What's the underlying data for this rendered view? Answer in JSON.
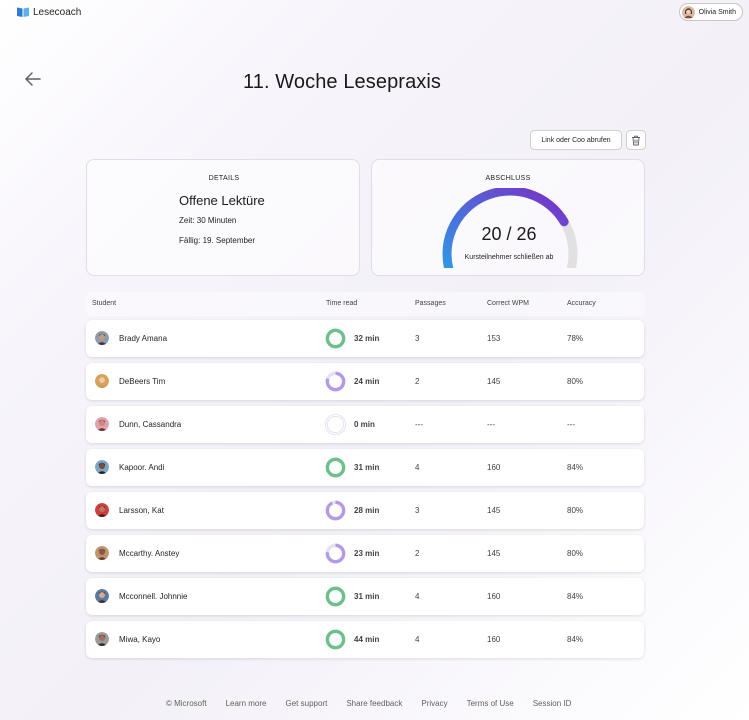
{
  "app": {
    "name": "Lesecoach",
    "user_name": "Olivia Smith"
  },
  "page": {
    "title": "11. Woche Lesepraxis"
  },
  "toolbar": {
    "link_label": "Link oder Coo abrufen"
  },
  "details": {
    "label": "DETAILS",
    "title": "Offene Lektüre",
    "time": "Zeit: 30 Minuten",
    "due": "Fällig: 19. September"
  },
  "completion": {
    "label": "ABSCHLUSS",
    "value_text": "20 / 26",
    "completed": 20,
    "total": 26,
    "caption": "Kursteilnehmer schließen ab"
  },
  "table": {
    "headers": {
      "student": "Student",
      "time_read": "Time read",
      "passages": "Passages",
      "wpm": "Correct WPM",
      "accuracy": "Accuracy"
    },
    "rows": [
      {
        "name": "Brady Amana",
        "time": "32 min",
        "progress": 1.0,
        "passages": "3",
        "wpm": "153",
        "accuracy": "78%",
        "ring_color": "#6cc08a"
      },
      {
        "name": "DeBeers Tim",
        "time": "24 min",
        "progress": 0.8,
        "passages": "2",
        "wpm": "145",
        "accuracy": "80%",
        "ring_color": "#b39ae8"
      },
      {
        "name": "Dunn, Cassandra",
        "time": "0 min",
        "progress": 0.0,
        "passages": "---",
        "wpm": "---",
        "accuracy": "---",
        "ring_color": "#b39ae8"
      },
      {
        "name": "Kapoor. Andi",
        "time": "31 min",
        "progress": 1.0,
        "passages": "4",
        "wpm": "160",
        "accuracy": "84%",
        "ring_color": "#6cc08a"
      },
      {
        "name": "Larsson, Kat",
        "time": "28 min",
        "progress": 0.93,
        "passages": "3",
        "wpm": "145",
        "accuracy": "80%",
        "ring_color": "#b39ae8"
      },
      {
        "name": "Mccarthy. Anstey",
        "time": "23 min",
        "progress": 0.77,
        "passages": "2",
        "wpm": "145",
        "accuracy": "80%",
        "ring_color": "#b39ae8"
      },
      {
        "name": "Mcconnell. Johnnie",
        "time": "31 min",
        "progress": 1.0,
        "passages": "4",
        "wpm": "160",
        "accuracy": "84%",
        "ring_color": "#6cc08a"
      },
      {
        "name": "Miwa, Kayo",
        "time": "44 min",
        "progress": 1.0,
        "passages": "4",
        "wpm": "160",
        "accuracy": "84%",
        "ring_color": "#6cc08a"
      }
    ]
  },
  "footer": {
    "copyright": "© Microsoft",
    "links": [
      "Learn more",
      "Get support",
      "Share feedback",
      "Privacy",
      "Terms of Use",
      "Session ID"
    ]
  },
  "colors": {
    "ring_complete": "#6cc08a",
    "ring_partial": "#b39ae8",
    "ring_track": "#e6e0f5",
    "gauge_start": "#2e9be6",
    "gauge_end": "#7a2fc7",
    "gauge_track": "#e1e1e1",
    "logo": "#2b7cd3"
  }
}
